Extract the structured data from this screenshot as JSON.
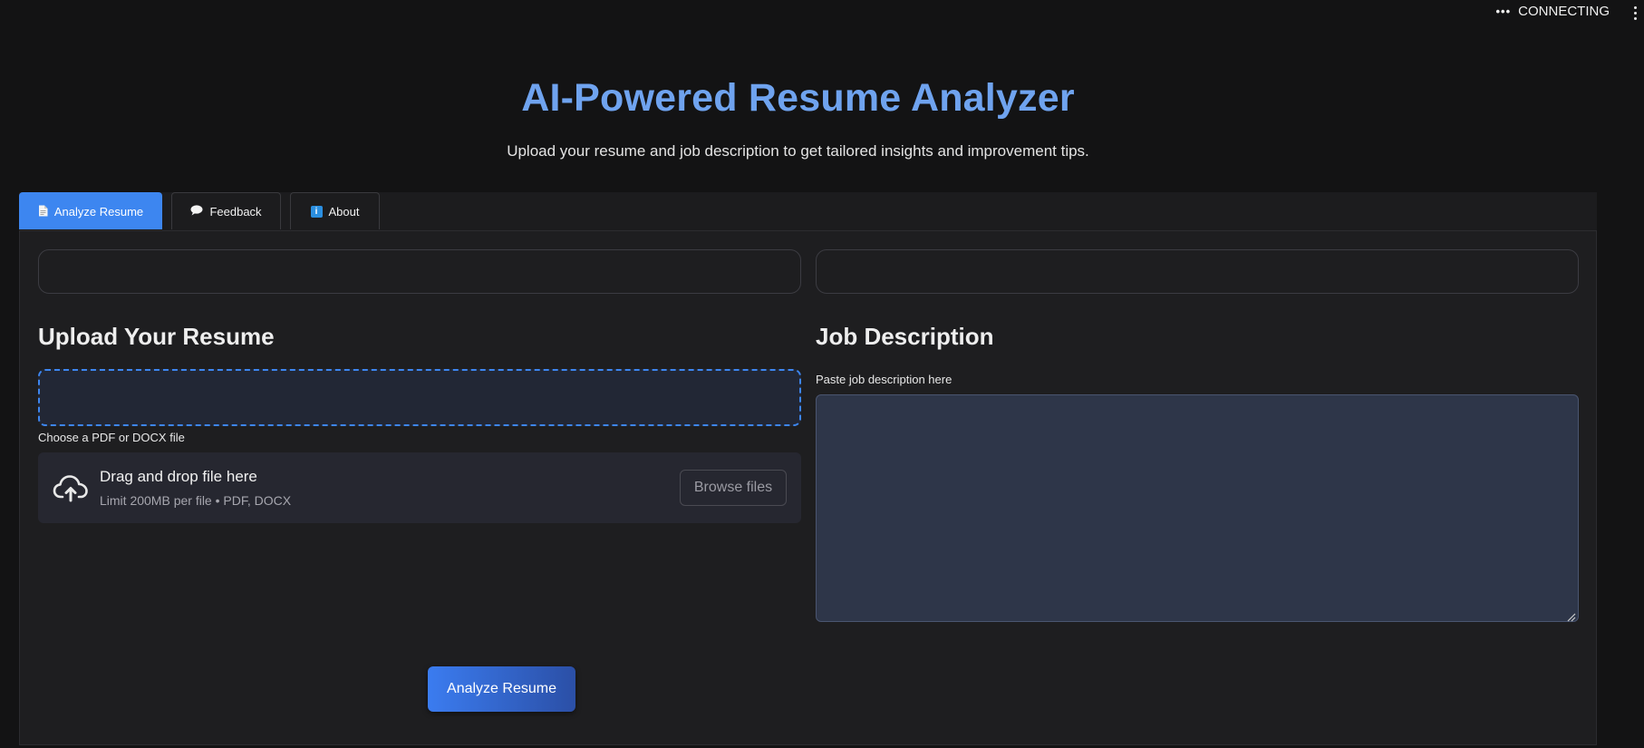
{
  "status": {
    "indicator_icon": "ellipsis-icon",
    "text": "CONNECTING",
    "menu_icon": "kebab-menu-icon"
  },
  "header": {
    "title": "AI-Powered Resume Analyzer",
    "subtitle": "Upload your resume and job description to get tailored insights and improvement tips."
  },
  "tabs": [
    {
      "label": "Analyze Resume",
      "icon": "document-icon",
      "active": true
    },
    {
      "label": "Feedback",
      "icon": "speech-bubble-icon",
      "active": false
    },
    {
      "label": "About",
      "icon": "info-icon",
      "active": false
    }
  ],
  "upload": {
    "heading": "Upload Your Resume",
    "label": "Choose a PDF or DOCX file",
    "dropzone_title": "Drag and drop file here",
    "dropzone_sub": "Limit 200MB per file • PDF, DOCX",
    "browse_label": "Browse files",
    "icon": "cloud-upload-icon"
  },
  "job": {
    "heading": "Job Description",
    "label": "Paste job description here",
    "value": ""
  },
  "actions": {
    "analyze_label": "Analyze Resume"
  },
  "colors": {
    "accent": "#3d86f0",
    "title": "#6fa3ef",
    "background": "#131314",
    "panel": "#1e1e20",
    "textarea": "#2e3649"
  }
}
